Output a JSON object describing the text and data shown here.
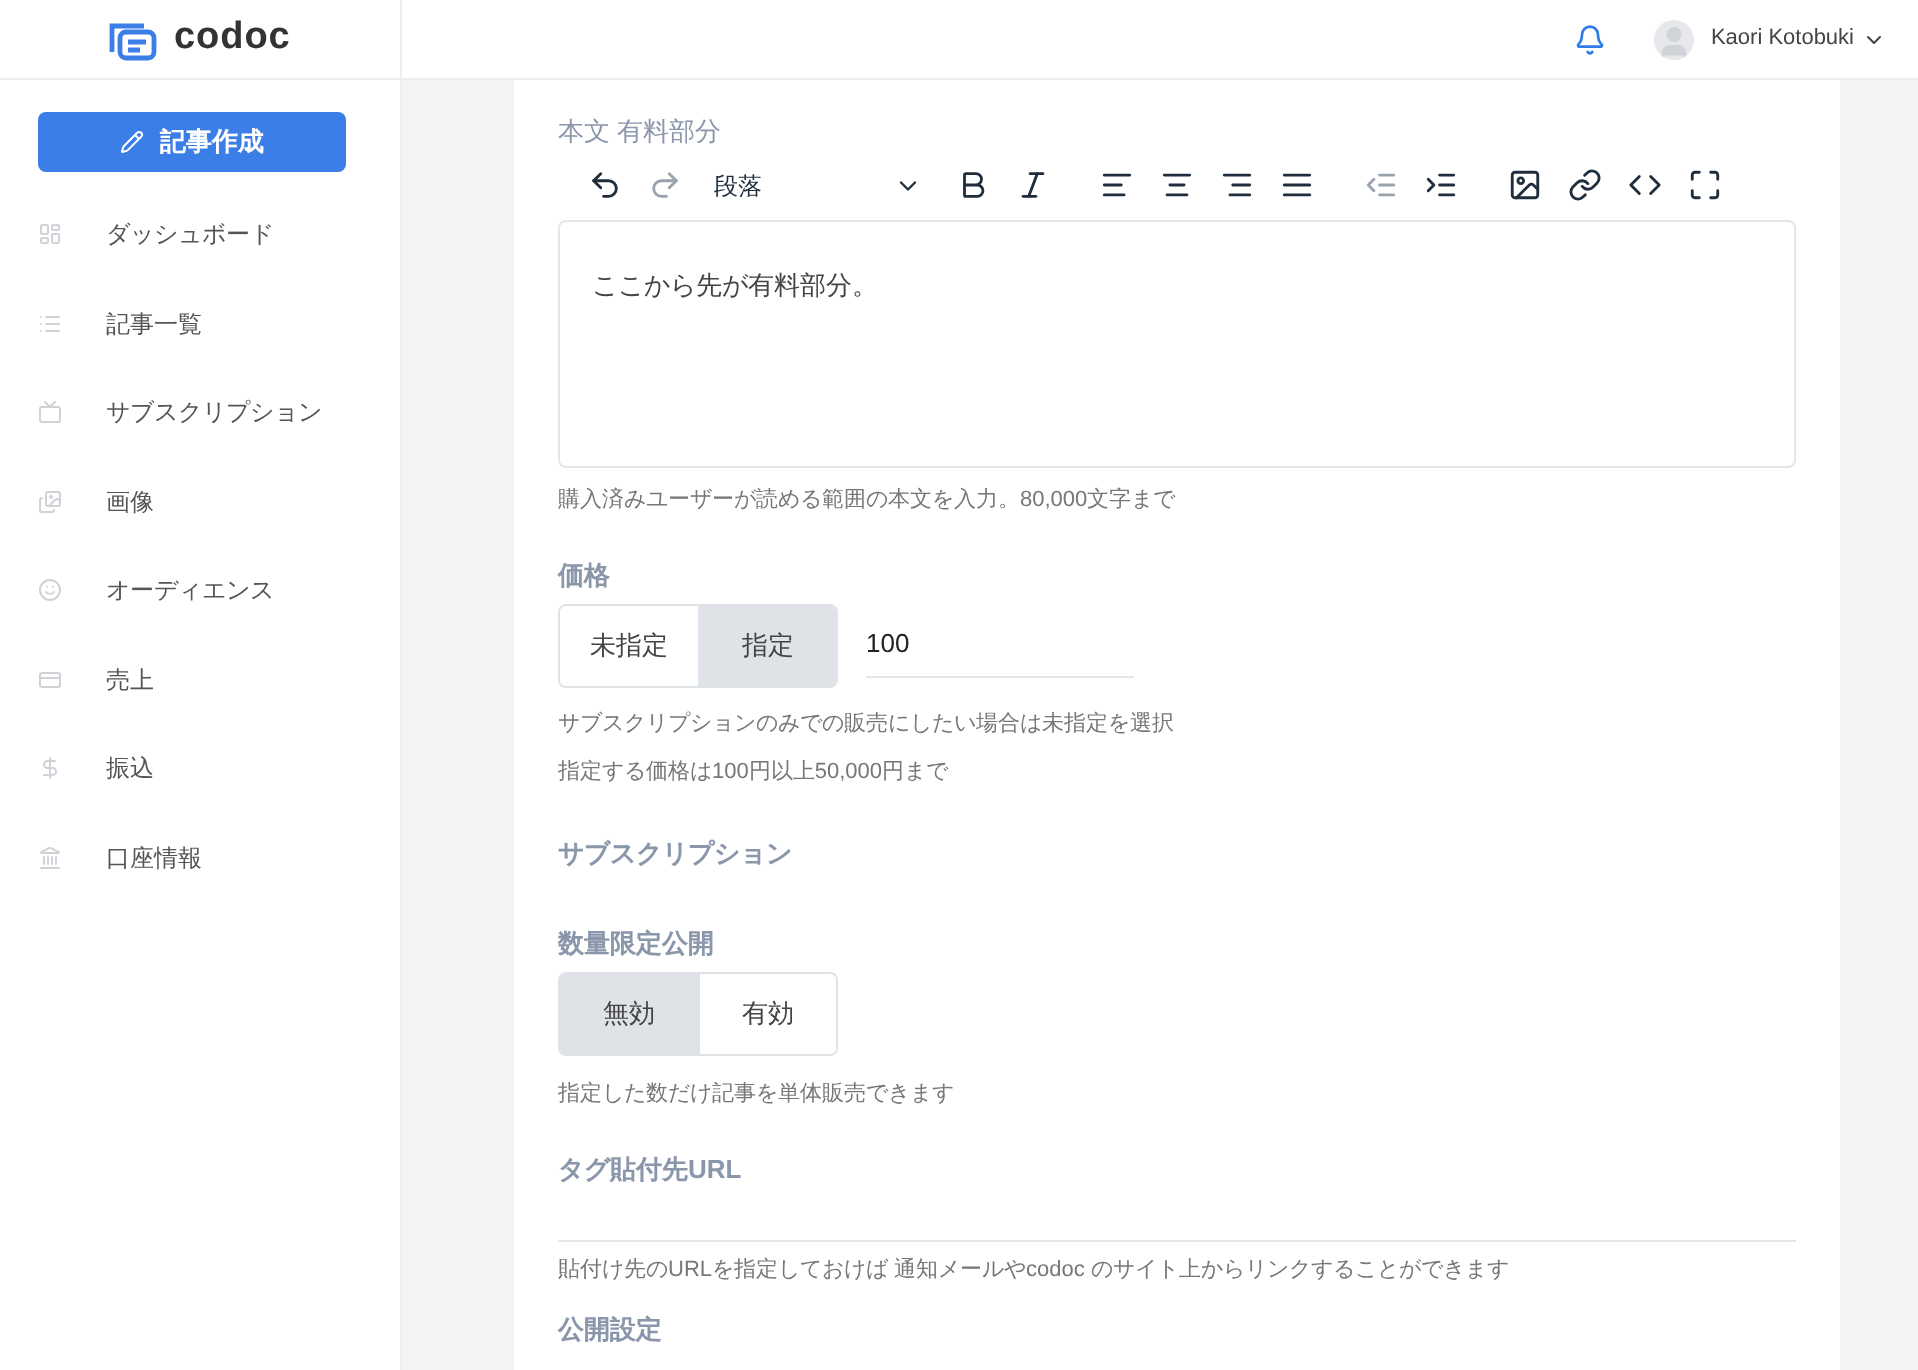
{
  "header": {
    "logo": "codoc",
    "user_name": "Kaori Kotobuki"
  },
  "sidebar": {
    "create_button": "記事作成",
    "items": [
      {
        "kind": "dashboard",
        "label": "ダッシュボード",
        "selected": false
      },
      {
        "kind": "list",
        "label": "記事一覧",
        "selected": false
      },
      {
        "kind": "subscription",
        "label": "サブスクリプション",
        "selected": false
      },
      {
        "kind": "image",
        "label": "画像",
        "selected": false
      },
      {
        "kind": "audience",
        "label": "オーディエンス",
        "selected": false
      },
      {
        "kind": "sales",
        "label": "売上",
        "selected": false
      },
      {
        "kind": "transfer",
        "label": "振込",
        "selected": false
      },
      {
        "kind": "bank",
        "label": "口座情報",
        "selected": false
      }
    ]
  },
  "editor": {
    "label": "本文 有料部分",
    "toolbar": [
      {
        "kind": "undo",
        "disabled": false
      },
      {
        "kind": "redo",
        "disabled": true
      },
      {
        "kind": "format",
        "label": "段落",
        "disabled": false
      },
      {
        "kind": "bold",
        "disabled": false
      },
      {
        "kind": "italic",
        "disabled": false
      },
      {
        "kind": "align-left",
        "disabled": false
      },
      {
        "kind": "align-center",
        "disabled": false
      },
      {
        "kind": "align-right",
        "disabled": false
      },
      {
        "kind": "justify",
        "disabled": false
      },
      {
        "kind": "outdent",
        "disabled": true
      },
      {
        "kind": "indent",
        "disabled": false
      },
      {
        "kind": "image",
        "disabled": false
      },
      {
        "kind": "link",
        "disabled": false
      },
      {
        "kind": "code",
        "disabled": false
      },
      {
        "kind": "fullscreen",
        "disabled": false
      }
    ],
    "content": "ここから先が有料部分。",
    "help": "購入済みユーザーが読める範囲の本文を入力。80,000文字まで"
  },
  "price": {
    "label": "価格",
    "options": [
      {
        "label": "未指定",
        "selected": false
      },
      {
        "label": "指定",
        "selected": true
      }
    ],
    "value": "100",
    "help": [
      "サブスクリプションのみでの販売にしたい場合は未指定を選択",
      "指定する価格は100円以上50,000円まで"
    ]
  },
  "subscription": {
    "label": "サブスクリプション"
  },
  "limited": {
    "label": "数量限定公開",
    "options": [
      {
        "label": "無効",
        "selected": true
      },
      {
        "label": "有効",
        "selected": false
      }
    ],
    "help": [
      "指定した数だけ記事を単体販売できます"
    ]
  },
  "tag_url": {
    "label": "タグ貼付先URL",
    "help": "貼付け先のURLを指定しておけば 通知メールやcodoc のサイト上からリンクすることができます"
  },
  "publish": {
    "label": "公開設定"
  }
}
